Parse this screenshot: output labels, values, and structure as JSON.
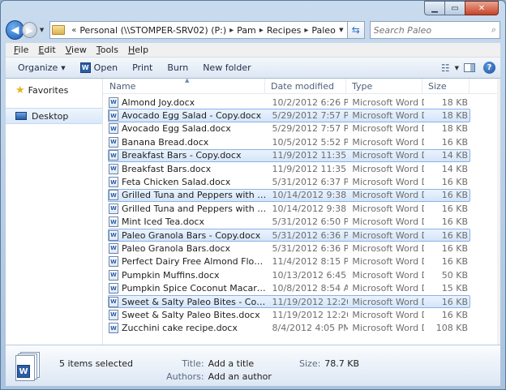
{
  "window": {
    "minimize_glyph": "▁",
    "maximize_glyph": "▭",
    "close_glyph": "✕"
  },
  "nav": {
    "back_glyph": "◀",
    "forward_glyph": "▶",
    "crumbs": [
      "Personal (\\\\STOMPER-SRV02) (P:)",
      "Pam",
      "Recipes",
      "Paleo"
    ],
    "overflow": "«",
    "search_placeholder": "Search Paleo"
  },
  "menubar": {
    "items": [
      {
        "key": "F",
        "rest": "ile"
      },
      {
        "key": "E",
        "rest": "dit"
      },
      {
        "key": "V",
        "rest": "iew"
      },
      {
        "key": "T",
        "rest": "ools"
      },
      {
        "key": "H",
        "rest": "elp"
      }
    ]
  },
  "toolbar": {
    "organize": "Organize",
    "open": "Open",
    "print": "Print",
    "burn": "Burn",
    "new_folder": "New folder",
    "help": "?"
  },
  "navpane": {
    "favorites": "Favorites",
    "desktop": "Desktop"
  },
  "columns": {
    "name": "Name",
    "date": "Date modified",
    "type": "Type",
    "size": "Size"
  },
  "files": [
    {
      "name": "Almond Joy.docx",
      "date": "10/2/2012 6:26 PM",
      "type": "Microsoft Word D...",
      "size": "18 KB",
      "selected": false
    },
    {
      "name": "Avocado Egg Salad - Copy.docx",
      "date": "5/29/2012 7:57 PM",
      "type": "Microsoft Word D...",
      "size": "18 KB",
      "selected": true
    },
    {
      "name": "Avocado Egg Salad.docx",
      "date": "5/29/2012 7:57 PM",
      "type": "Microsoft Word D...",
      "size": "18 KB",
      "selected": false
    },
    {
      "name": "Banana Bread.docx",
      "date": "10/5/2012 5:52 PM",
      "type": "Microsoft Word D...",
      "size": "16 KB",
      "selected": false
    },
    {
      "name": "Breakfast Bars - Copy.docx",
      "date": "11/9/2012 11:35 AM",
      "type": "Microsoft Word D...",
      "size": "14 KB",
      "selected": true
    },
    {
      "name": "Breakfast Bars.docx",
      "date": "11/9/2012 11:35 AM",
      "type": "Microsoft Word D...",
      "size": "14 KB",
      "selected": false
    },
    {
      "name": "Feta Chicken Salad.docx",
      "date": "5/31/2012 6:37 PM",
      "type": "Microsoft Word D...",
      "size": "16 KB",
      "selected": false
    },
    {
      "name": "Grilled Tuna and Peppers with Caper Vin...",
      "date": "10/14/2012 9:38 PM",
      "type": "Microsoft Word D...",
      "size": "16 KB",
      "selected": true
    },
    {
      "name": "Grilled Tuna and Peppers with Caper Vin...",
      "date": "10/14/2012 9:38 PM",
      "type": "Microsoft Word D...",
      "size": "16 KB",
      "selected": false
    },
    {
      "name": "Mint Iced Tea.docx",
      "date": "5/31/2012 6:50 PM",
      "type": "Microsoft Word D...",
      "size": "16 KB",
      "selected": false
    },
    {
      "name": "Paleo Granola Bars - Copy.docx",
      "date": "5/31/2012 6:36 PM",
      "type": "Microsoft Word D...",
      "size": "16 KB",
      "selected": true
    },
    {
      "name": "Paleo Granola Bars.docx",
      "date": "5/31/2012 6:36 PM",
      "type": "Microsoft Word D...",
      "size": "16 KB",
      "selected": false
    },
    {
      "name": "Perfect Dairy Free Almond Flour Pancake...",
      "date": "11/4/2012 8:15 PM",
      "type": "Microsoft Word D...",
      "size": "16 KB",
      "selected": false
    },
    {
      "name": "Pumpkin Muffins.docx",
      "date": "10/13/2012 6:45 PM",
      "type": "Microsoft Word D...",
      "size": "50 KB",
      "selected": false
    },
    {
      "name": "Pumpkin Spice Coconut Macaroons.docx",
      "date": "10/8/2012 8:54 AM",
      "type": "Microsoft Word D...",
      "size": "15 KB",
      "selected": false
    },
    {
      "name": "Sweet & Salty Paleo Bites - Copy.docx",
      "date": "11/19/2012 12:20 ...",
      "type": "Microsoft Word D...",
      "size": "16 KB",
      "selected": true
    },
    {
      "name": "Sweet & Salty Paleo Bites.docx",
      "date": "11/19/2012 12:20 ...",
      "type": "Microsoft Word D...",
      "size": "16 KB",
      "selected": false
    },
    {
      "name": "Zucchini cake recipe.docx",
      "date": "8/4/2012 4:05 PM",
      "type": "Microsoft Word D...",
      "size": "108 KB",
      "selected": false
    }
  ],
  "details": {
    "selection": "5 items selected",
    "title_label": "Title:",
    "title_value": "Add a title",
    "authors_label": "Authors:",
    "authors_value": "Add an author",
    "size_label": "Size:",
    "size_value": "78.7 KB"
  },
  "colors": {
    "selection_fill": "#d4e6fa",
    "selection_border": "#8db2e3",
    "word_blue": "#2a5ea8"
  }
}
